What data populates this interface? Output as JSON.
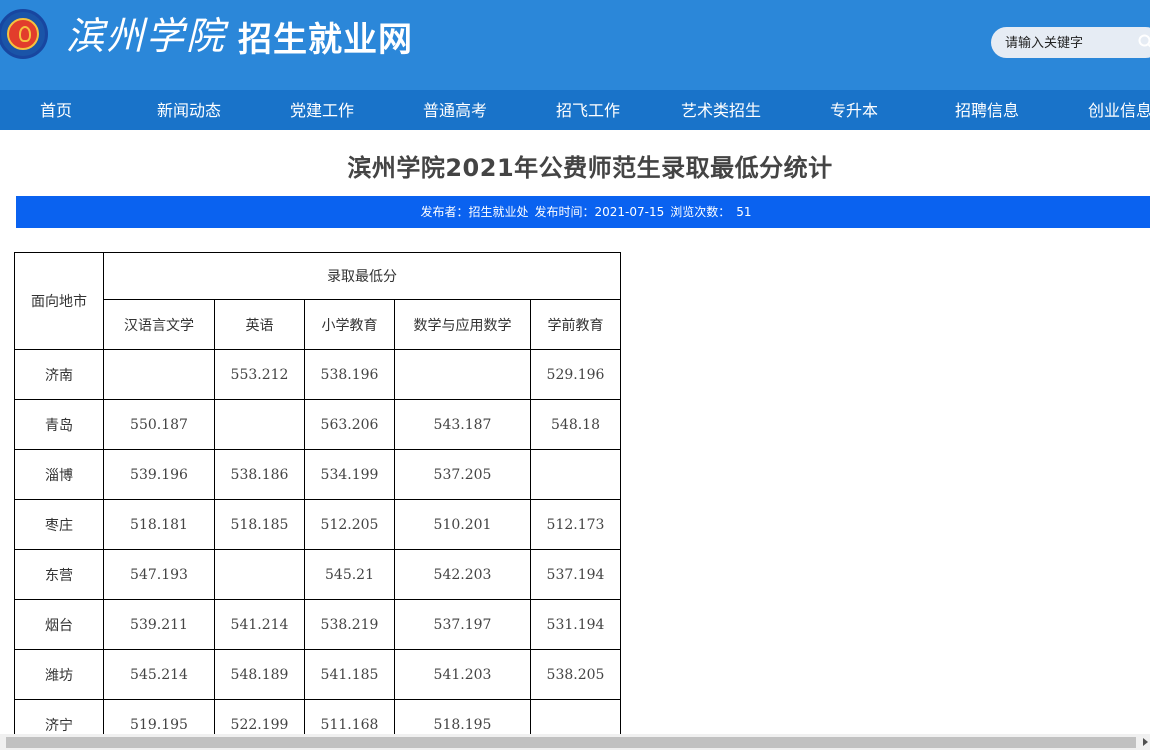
{
  "header": {
    "brand_script": "滨州学院",
    "site_title": "招生就业网",
    "search_placeholder": "请输入关键字"
  },
  "nav": {
    "items": [
      {
        "label": "首页"
      },
      {
        "label": "新闻动态"
      },
      {
        "label": "党建工作"
      },
      {
        "label": "普通高考"
      },
      {
        "label": "招飞工作"
      },
      {
        "label": "艺术类招生"
      },
      {
        "label": "专升本"
      },
      {
        "label": "招聘信息"
      },
      {
        "label": "创业信息"
      }
    ]
  },
  "article": {
    "title": "滨州学院2021年公费师范生录取最低分统计",
    "meta": {
      "publisher": "发布者：招生就业处",
      "date": "发布时间：2021-07-15",
      "views_label": "浏览次数：",
      "views": "51"
    }
  },
  "table": {
    "region_header": "面向地市",
    "group_header": "录取最低分",
    "columns": [
      "汉语言文学",
      "英语",
      "小学教育",
      "数学与应用数学",
      "学前教育"
    ],
    "rows": [
      {
        "city": "济南",
        "values": [
          "",
          "553.212",
          "538.196",
          "",
          "529.196"
        ]
      },
      {
        "city": "青岛",
        "values": [
          "550.187",
          "",
          "563.206",
          "543.187",
          "548.18"
        ]
      },
      {
        "city": "淄博",
        "values": [
          "539.196",
          "538.186",
          "534.199",
          "537.205",
          ""
        ]
      },
      {
        "city": "枣庄",
        "values": [
          "518.181",
          "518.185",
          "512.205",
          "510.201",
          "512.173"
        ]
      },
      {
        "city": "东营",
        "values": [
          "547.193",
          "",
          "545.21",
          "542.203",
          "537.194"
        ]
      },
      {
        "city": "烟台",
        "values": [
          "539.211",
          "541.214",
          "538.219",
          "537.197",
          "531.194"
        ]
      },
      {
        "city": "潍坊",
        "values": [
          "545.214",
          "548.189",
          "541.185",
          "541.203",
          "538.205"
        ]
      },
      {
        "city": "济宁",
        "values": [
          "519.195",
          "522.199",
          "511.168",
          "518.195",
          ""
        ]
      }
    ]
  },
  "colors": {
    "header_bg": "#2b87d9",
    "nav_bg": "#1973c9",
    "meta_bar_bg": "#0a62f0"
  }
}
